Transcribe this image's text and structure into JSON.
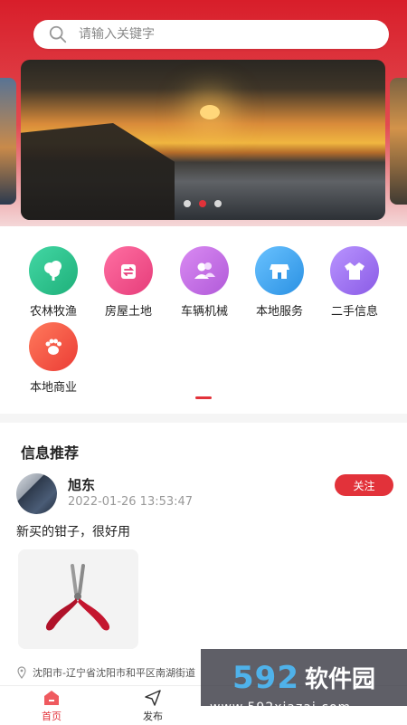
{
  "search": {
    "placeholder": "请输入关键字"
  },
  "banner": {
    "active_index": 1,
    "slides": 3
  },
  "categories": [
    {
      "label": "农林牧渔",
      "icon": "tree-icon",
      "color": "#2dc48f"
    },
    {
      "label": "房屋土地",
      "icon": "house-transfer-icon",
      "color": "#f0508b"
    },
    {
      "label": "车辆机械",
      "icon": "users-icon",
      "color": "#c06ae6"
    },
    {
      "label": "本地服务",
      "icon": "shop-icon",
      "color": "#3fa7f2"
    },
    {
      "label": "二手信息",
      "icon": "shirt-icon",
      "color": "#9f6ef0"
    },
    {
      "label": "本地商业",
      "icon": "paw-icon",
      "color": "#f5584a"
    }
  ],
  "feed": {
    "title": "信息推荐",
    "post": {
      "name": "旭东",
      "time": "2022-01-26 13:53:47",
      "follow_label": "关注",
      "text": "新买的钳子，很好用",
      "location": "沈阳市-辽宁省沈阳市和平区南湖街道"
    }
  },
  "tabbar": {
    "tabs": [
      {
        "label": "首页",
        "icon": "home-icon",
        "active": true
      },
      {
        "label": "发布",
        "icon": "send-icon",
        "active": false
      }
    ]
  },
  "watermark": {
    "brand": "592",
    "name": "软件园",
    "url": "www.592xiazai.com"
  },
  "colors": {
    "accent": "#e2323a",
    "header_red": "#d81e2a"
  }
}
